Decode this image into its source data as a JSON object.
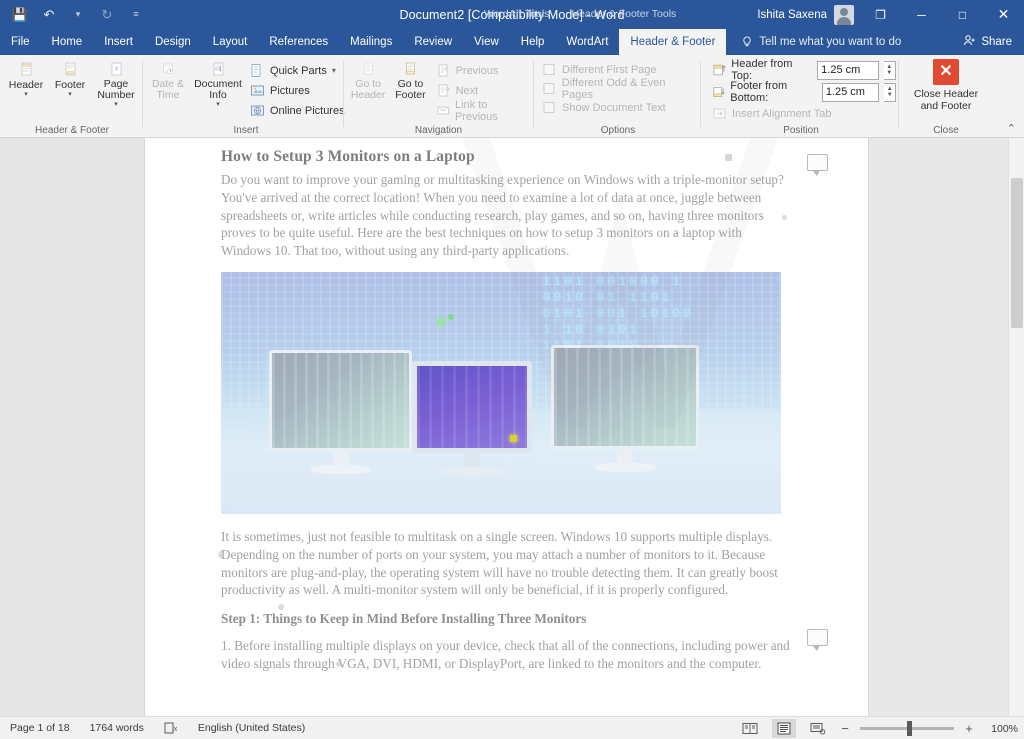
{
  "window": {
    "title": "Document2 [Compatibility Mode]  -  Word",
    "contextual_tools": [
      "WordArt Tools",
      "Header & Footer Tools"
    ],
    "user_name": "Ishita Saxena",
    "quick_access": [
      {
        "name": "save-icon",
        "glyph": "💾"
      },
      {
        "name": "undo-icon",
        "glyph": "↶"
      },
      {
        "name": "undo-dropdown-icon",
        "glyph": "▾"
      },
      {
        "name": "redo-icon",
        "glyph": "↻"
      },
      {
        "name": "customize-qat-icon",
        "glyph": "≡"
      }
    ],
    "controls": {
      "ribbon_display_options": "❐",
      "minimize": "─",
      "maximize": "□",
      "close": "✕"
    }
  },
  "tabs": [
    {
      "label": "File",
      "active": false
    },
    {
      "label": "Home",
      "active": false
    },
    {
      "label": "Insert",
      "active": false
    },
    {
      "label": "Design",
      "active": false
    },
    {
      "label": "Layout",
      "active": false
    },
    {
      "label": "References",
      "active": false
    },
    {
      "label": "Mailings",
      "active": false
    },
    {
      "label": "Review",
      "active": false
    },
    {
      "label": "View",
      "active": false
    },
    {
      "label": "Help",
      "active": false
    },
    {
      "label": "WordArt",
      "active": false
    },
    {
      "label": "Header & Footer",
      "active": true
    }
  ],
  "tell_me": "Tell me what you want to do",
  "share_label": "Share",
  "ribbon": {
    "groups": [
      {
        "title": "Header & Footer",
        "buttons": [
          {
            "label": "Header",
            "icon": "header-icon",
            "dropdown": true,
            "disabled": false
          },
          {
            "label": "Footer",
            "icon": "footer-icon",
            "dropdown": true,
            "disabled": false
          },
          {
            "label": "Page Number",
            "icon": "page-number-icon",
            "dropdown": true,
            "disabled": false
          }
        ]
      },
      {
        "title": "Insert",
        "buttons": [
          {
            "label": "Date & Time",
            "icon": "date-time-icon",
            "dropdown": false,
            "disabled": true
          },
          {
            "label": "Document Info",
            "icon": "document-info-icon",
            "dropdown": true,
            "disabled": false
          }
        ],
        "small_items": [
          {
            "label": "Quick Parts",
            "icon": "quick-parts-icon",
            "dropdown": true,
            "disabled": false
          },
          {
            "label": "Pictures",
            "icon": "pictures-icon",
            "dropdown": false,
            "disabled": false
          },
          {
            "label": "Online Pictures",
            "icon": "online-pictures-icon",
            "dropdown": false,
            "disabled": false
          }
        ]
      },
      {
        "title": "Navigation",
        "buttons": [
          {
            "label": "Go to Header",
            "icon": "go-to-header-icon",
            "dropdown": false,
            "disabled": true
          },
          {
            "label": "Go to Footer",
            "icon": "go-to-footer-icon",
            "dropdown": false,
            "disabled": false
          }
        ],
        "small_items": [
          {
            "label": "Previous",
            "icon": "previous-icon",
            "disabled": true
          },
          {
            "label": "Next",
            "icon": "next-icon",
            "disabled": true
          },
          {
            "label": "Link to Previous",
            "icon": "link-to-previous-icon",
            "disabled": true
          }
        ]
      },
      {
        "title": "Options",
        "checkboxes": [
          {
            "label": "Different First Page",
            "checked": false,
            "disabled": true
          },
          {
            "label": "Different Odd & Even Pages",
            "checked": false,
            "disabled": true
          },
          {
            "label": "Show Document Text",
            "checked": false,
            "disabled": true
          }
        ]
      },
      {
        "title": "Position",
        "fields": [
          {
            "label": "Header from Top:",
            "value": "1.25 cm",
            "icon": "header-from-top-icon",
            "disabled": false
          },
          {
            "label": "Footer from Bottom:",
            "value": "1.25 cm",
            "icon": "footer-from-bottom-icon",
            "disabled": false
          }
        ],
        "small_items": [
          {
            "label": "Insert Alignment Tab",
            "icon": "insert-alignment-tab-icon",
            "disabled": true
          }
        ]
      },
      {
        "title": "Close",
        "buttons": [
          {
            "label": "Close Header and Footer",
            "icon": "close-header-footer-icon",
            "disabled": false
          }
        ]
      }
    ],
    "collapse_icon": "⌃"
  },
  "document": {
    "heading": "How to Setup 3 Monitors on a Laptop",
    "paragraph_1": "Do you want to improve your gaming or multitasking experience on Windows with a triple-monitor setup? You've arrived at the correct location! When you need to examine a lot of data at once, juggle between spreadsheets or, write articles while conducting research, play games, and so on, having three monitors proves to be quite useful. Here are the best techniques on how to setup 3 monitors on a laptop with Windows 10. That too, without using any third-party applications.",
    "image_alt": "Three desktop monitors on a desk with a blue digital city skyline and binary code background",
    "image_binary_text": "1101 001000 1\n0010 01 1101\n0101 001 10100\n1 10 0101\n1101 0010",
    "paragraph_2": "It is sometimes, just not feasible to multitask on a single screen. Windows 10 supports multiple displays. Depending on the number of ports on your system, you may attach a number of monitors to it. Because monitors are plug-and-play, the operating system will have no trouble detecting them. It can greatly boost productivity as well. A multi-monitor system will only be beneficial, if it is properly configured.",
    "subheading": "Step 1: Things to Keep in Mind Before Installing Three Monitors",
    "paragraph_3": "1. Before installing multiple displays on your device, check that all of the connections, including power and video signals through VGA, DVI, HDMI, or DisplayPort, are linked to the monitors and the computer."
  },
  "status_bar": {
    "page": "Page 1 of 18",
    "words": "1764 words",
    "proofing_icon": "proofing-errors-icon",
    "language": "English (United States)",
    "views": [
      {
        "name": "read-mode-view",
        "selected": false
      },
      {
        "name": "print-layout-view",
        "selected": true
      },
      {
        "name": "web-layout-view",
        "selected": false
      }
    ],
    "zoom_out": "−",
    "zoom_in": "+",
    "zoom_level": "100%"
  },
  "colors": {
    "word_blue": "#2b579a",
    "ribbon_bg": "#f3f3f3",
    "close_red": "#e04a30",
    "doc_bg": "#e6e6e6"
  }
}
